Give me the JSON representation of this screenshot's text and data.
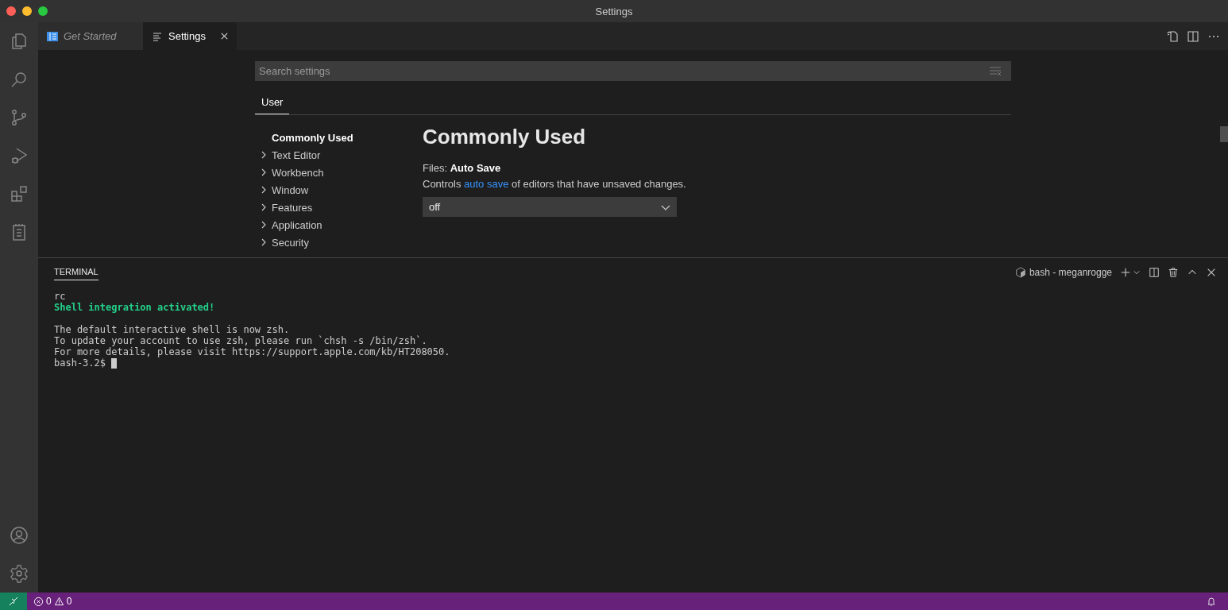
{
  "window": {
    "title": "Settings"
  },
  "tabs": [
    {
      "label": "Get Started",
      "selected": false,
      "preview": true,
      "kind": "welcome"
    },
    {
      "label": "Settings",
      "selected": true,
      "preview": false,
      "kind": "settings"
    }
  ],
  "settings": {
    "search": {
      "placeholder": "Search settings"
    },
    "scopes": [
      {
        "label": "User",
        "selected": true
      }
    ],
    "toc": [
      {
        "label": "Commonly Used",
        "selected": true,
        "expandable": false
      },
      {
        "label": "Text Editor",
        "selected": false,
        "expandable": true
      },
      {
        "label": "Workbench",
        "selected": false,
        "expandable": true
      },
      {
        "label": "Window",
        "selected": false,
        "expandable": true
      },
      {
        "label": "Features",
        "selected": false,
        "expandable": true
      },
      {
        "label": "Application",
        "selected": false,
        "expandable": true
      },
      {
        "label": "Security",
        "selected": false,
        "expandable": true
      }
    ],
    "heading": "Commonly Used",
    "setting": {
      "category": "Files:",
      "name": "Auto Save",
      "description_before": "Controls ",
      "description_link": "auto save",
      "description_after": " of editors that have unsaved changes.",
      "value": "off"
    }
  },
  "panel": {
    "tabs": [
      {
        "label": "TERMINAL",
        "selected": true
      }
    ],
    "terminal_name": "bash - meganrogge",
    "blocks": [
      {
        "lines": [
          {
            "text": "rc",
            "kind": "plain"
          },
          {
            "text": "Shell integration activated!",
            "kind": "success"
          }
        ]
      },
      {
        "lines": [
          {
            "text": "The default interactive shell is now zsh.",
            "kind": "plain"
          },
          {
            "text": "To update your account to use zsh, please run `chsh -s /bin/zsh`.",
            "kind": "plain"
          },
          {
            "text": "For more details, please visit https://support.apple.com/kb/HT208050.",
            "kind": "plain"
          },
          {
            "text": "bash-3.2$",
            "kind": "prompt"
          }
        ]
      }
    ]
  },
  "status_bar": {
    "errors": "0",
    "warnings": "0"
  }
}
